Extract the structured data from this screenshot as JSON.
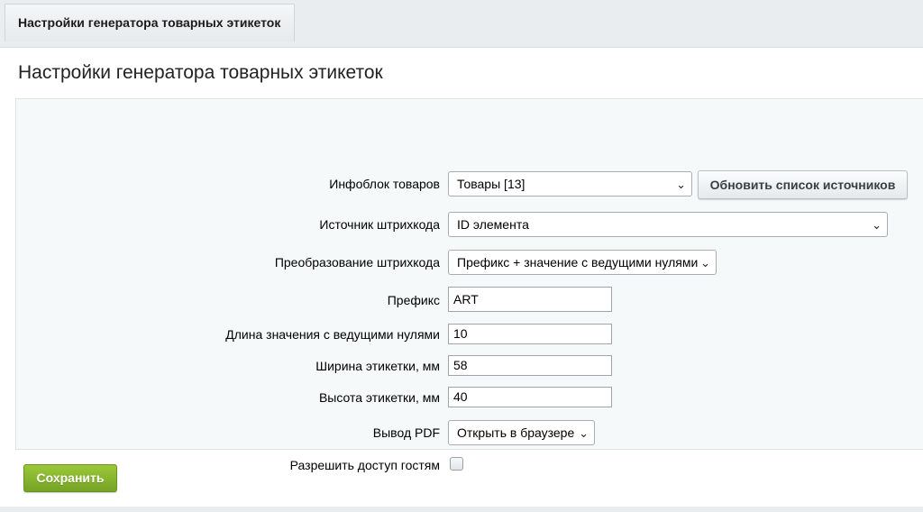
{
  "tab": {
    "label": "Настройки генератора товарных этикеток"
  },
  "page": {
    "title": "Настройки генератора товарных этикеток"
  },
  "form": {
    "infoblock": {
      "label": "Инфоблок товаров",
      "value": "Товары [13]",
      "button": "Обновить список источников"
    },
    "barcode_source": {
      "label": "Источник штрихкода",
      "value": "ID элемента"
    },
    "barcode_transform": {
      "label": "Преобразование штрихкода",
      "value": "Префикс + значение с ведущими нулями"
    },
    "prefix": {
      "label": "Префикс",
      "value": "ART"
    },
    "length": {
      "label": "Длина значения с ведущими нулями",
      "value": "10"
    },
    "width": {
      "label": "Ширина этикетки, мм",
      "value": "58"
    },
    "height": {
      "label": "Высота этикетки, мм",
      "value": "40"
    },
    "pdf_output": {
      "label": "Вывод PDF",
      "value": "Открыть в браузере"
    },
    "guest_access": {
      "label": "Разрешить доступ гостям",
      "checked": false
    }
  },
  "actions": {
    "save": "Сохранить"
  },
  "icons": {
    "dropdown": "chevron-down-icon"
  },
  "colors": {
    "save_button": "#88b62f",
    "background": "#e9edef",
    "form_area": "#f5f9f9"
  }
}
